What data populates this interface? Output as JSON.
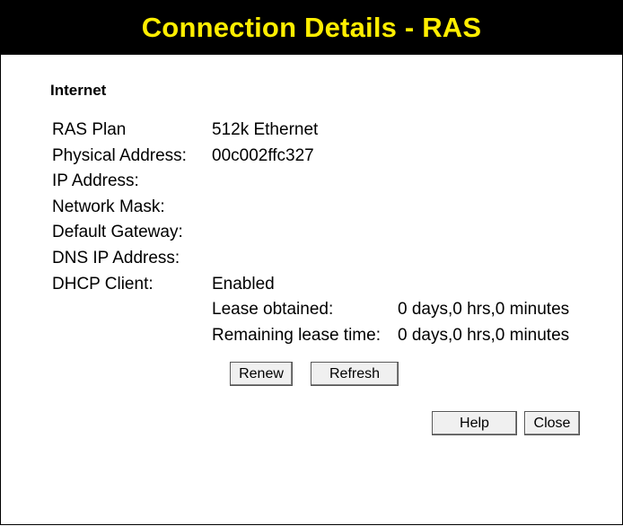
{
  "title": "Connection Details - RAS",
  "colors": {
    "title_bg": "#000000",
    "title_text": "#ffee00"
  },
  "section": "Internet",
  "fields": [
    {
      "label": "RAS Plan",
      "value": "512k Ethernet"
    },
    {
      "label": "Physical Address:",
      "value": "00c002ffc327"
    },
    {
      "label": "IP Address:",
      "value": ""
    },
    {
      "label": "Network Mask:",
      "value": ""
    },
    {
      "label": "Default Gateway:",
      "value": ""
    },
    {
      "label": "DNS IP Address:",
      "value": ""
    },
    {
      "label": "DHCP Client:",
      "value": "Enabled"
    }
  ],
  "lease": [
    {
      "label": "Lease obtained:",
      "value": "0 days,0 hrs,0 minutes"
    },
    {
      "label": "Remaining lease time:",
      "value": "0 days,0 hrs,0 minutes"
    }
  ],
  "buttons": {
    "renew": "Renew",
    "refresh": "Refresh",
    "help": "Help",
    "close": "Close"
  }
}
